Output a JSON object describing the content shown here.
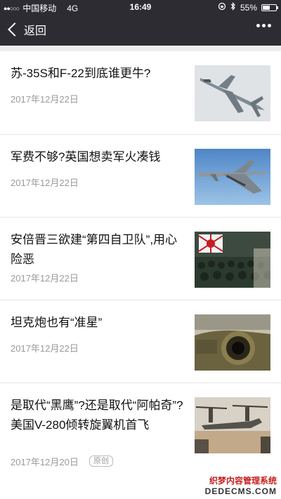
{
  "status_bar": {
    "carrier": "中国移动",
    "network": "4G",
    "time": "16:49",
    "battery": "55%",
    "battery_level": 0.55
  },
  "nav": {
    "back_label": "返回",
    "more_icon": "more-dots-icon"
  },
  "articles": [
    {
      "title": "苏-35S和F-22到底谁更牛?",
      "date": "2017年12月22日",
      "badge": ""
    },
    {
      "title": "军费不够?英国想卖军火凑钱",
      "date": "2017年12月22日",
      "badge": ""
    },
    {
      "title": "安倍晋三欲建“第四自卫队”,用心险恶",
      "date": "2017年12月22日",
      "badge": ""
    },
    {
      "title": "坦克炮也有“准星”",
      "date": "2017年12月22日",
      "badge": ""
    },
    {
      "title": "是取代“黑鹰”?还是取代“阿帕奇”?美国V-280倾转旋翼机首飞",
      "date": "2017年12月20日",
      "badge": "原创"
    }
  ],
  "watermark": {
    "cn": "织梦内容管理系统",
    "en": "DEDECMS.COM"
  }
}
